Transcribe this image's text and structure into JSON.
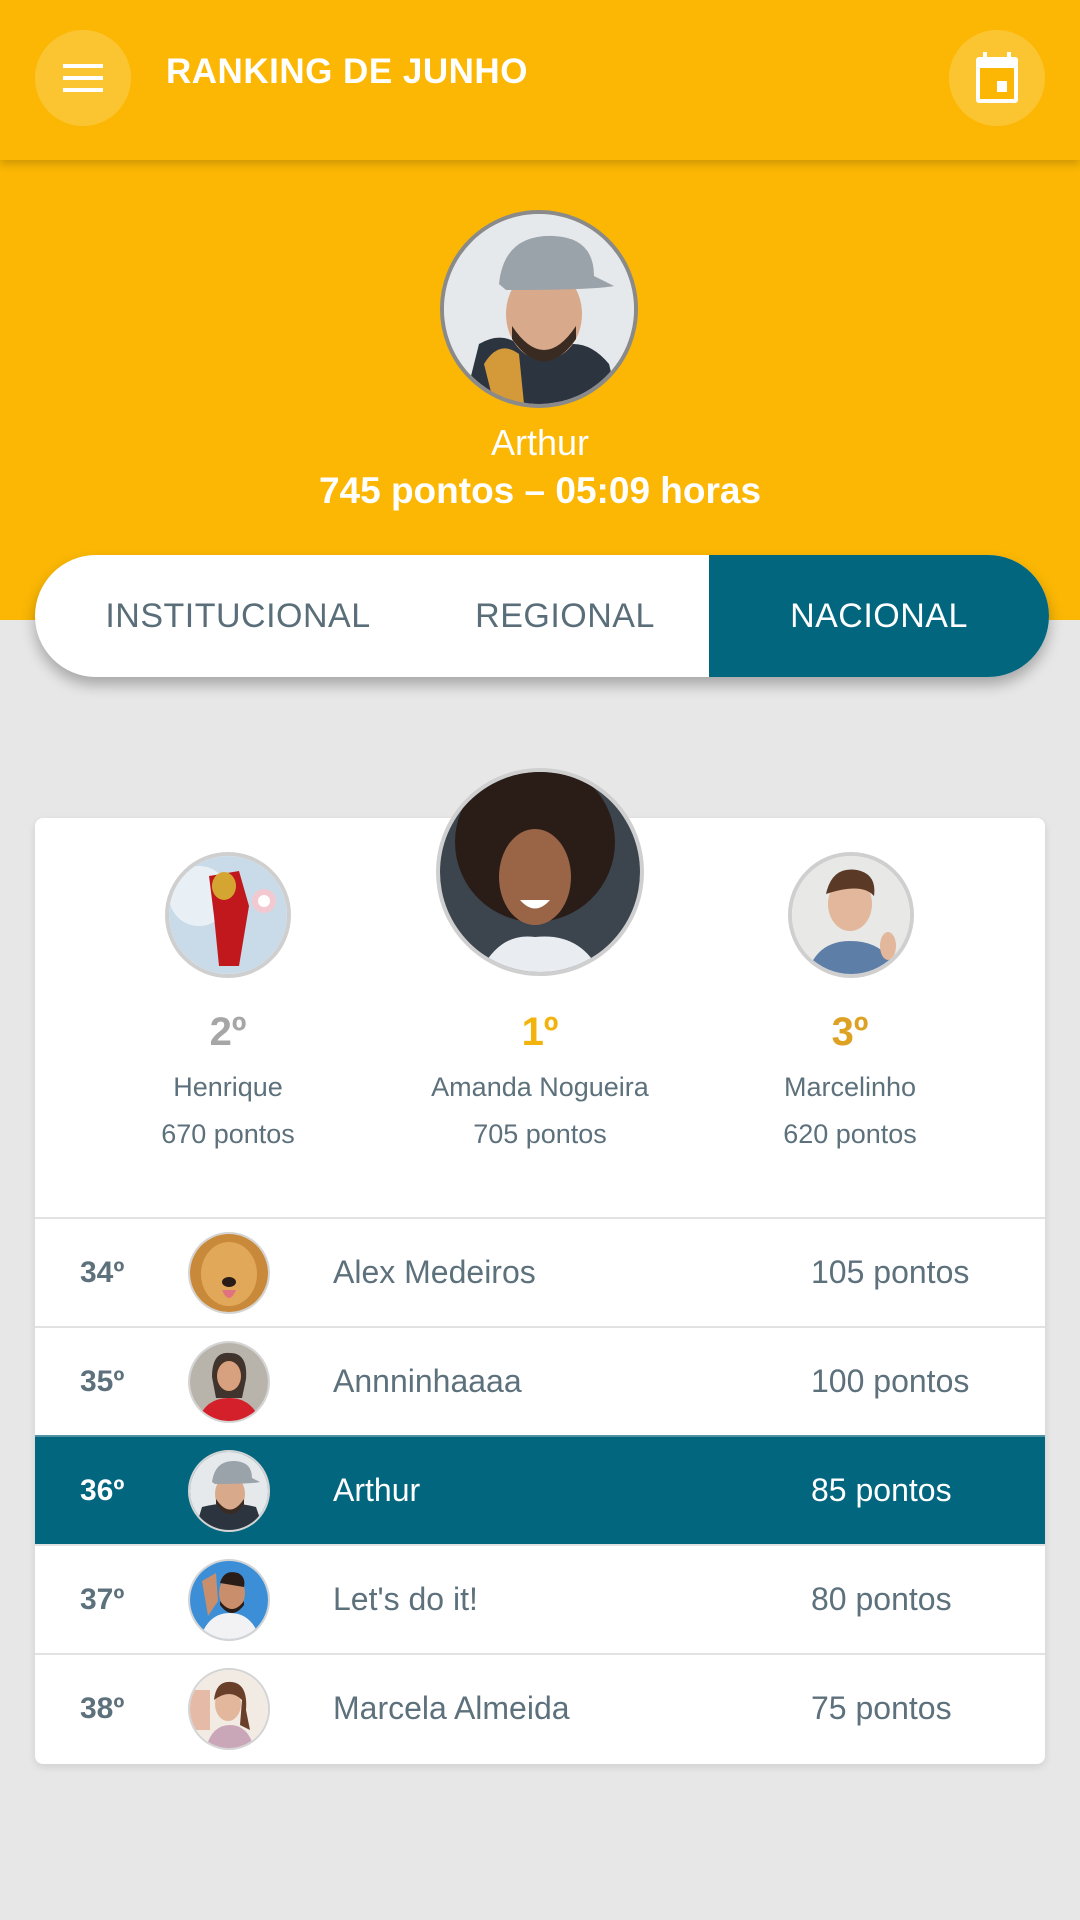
{
  "appbar": {
    "title": "RANKING DE JUNHO",
    "menu_icon": "hamburger-menu-icon",
    "calendar_icon": "calendar-icon"
  },
  "current_user": {
    "name": "Arthur",
    "summary": "745 pontos – 05:09 horas",
    "points": 745,
    "hours": "05:09"
  },
  "tabs": [
    {
      "label": "INSTITUCIONAL",
      "active": false
    },
    {
      "label": "REGIONAL",
      "active": false
    },
    {
      "label": "NACIONAL",
      "active": true
    }
  ],
  "podium": [
    {
      "rank": "1º",
      "name": "Amanda Nogueira",
      "points": "705 pontos"
    },
    {
      "rank": "2º",
      "name": "Henrique",
      "points": "670 pontos"
    },
    {
      "rank": "3º",
      "name": "Marcelinho",
      "points": "620 pontos"
    }
  ],
  "ranking_list": [
    {
      "position": "34º",
      "name": "Alex Medeiros",
      "points": "105 pontos",
      "highlighted": false
    },
    {
      "position": "35º",
      "name": "Annninhaaaa",
      "points": "100 pontos",
      "highlighted": false
    },
    {
      "position": "36º",
      "name": "Arthur",
      "points": "85 pontos",
      "highlighted": true
    },
    {
      "position": "37º",
      "name": "Let's do it!",
      "points": "80 pontos",
      "highlighted": false
    },
    {
      "position": "38º",
      "name": "Marcela Almeida",
      "points": "75 pontos",
      "highlighted": false
    }
  ],
  "colors": {
    "primary_yellow": "#fbb704",
    "active_teal": "#02667f",
    "gold": "#f2b40c",
    "silver": "#a6a6a6",
    "bronze": "#dda224",
    "text_gray": "#5d717c",
    "background": "#e7e7e7"
  }
}
